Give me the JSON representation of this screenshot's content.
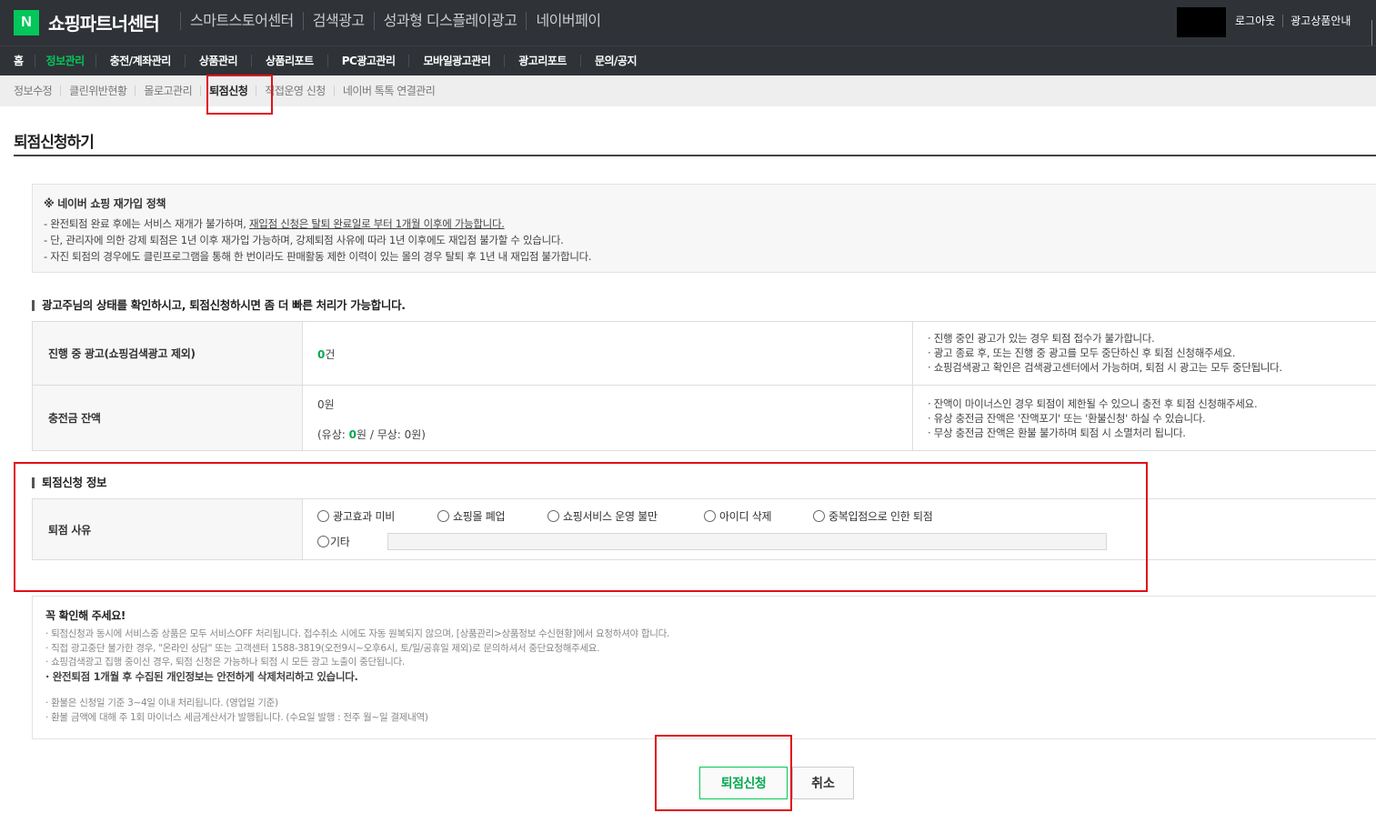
{
  "header": {
    "logo_letter": "N",
    "brand": "쇼핑파트너센터",
    "nav": [
      "스마트스토어센터",
      "검색광고",
      "성과형 디스플레이광고",
      "네이버페이"
    ],
    "links": [
      "로그아웃",
      "광고상품안내"
    ]
  },
  "main_menu": {
    "items": [
      "홈",
      "정보관리",
      "충전/계좌관리",
      "상품관리",
      "상품리포트",
      "PC광고관리",
      "모바일광고관리",
      "광고리포트",
      "문의/공지"
    ],
    "active_index": 1
  },
  "sub_menu": {
    "items": [
      "정보수정",
      "클린위반현황",
      "몰로고관리",
      "퇴점신청",
      "직접운영 신청",
      "네이버 톡톡 연결관리"
    ],
    "active_index": 3
  },
  "page_title": "퇴점신청하기",
  "policy": {
    "head": "※ 네이버 쇼핑 재가입 정책",
    "line1_prefix": "- 완전퇴점 완료 후에는 서비스 재개가 불가하며, ",
    "line1_underlined": "재입점 신청은 탈퇴 완료일로 부터 1개월 이후에 가능합니다.",
    "line2": "- 단, 관리자에 의한 강제 퇴점은 1년 이후 재가입 가능하며, 강제퇴점 사유에 따라 1년 이후에도 재입점 불가할 수 있습니다.",
    "line3": "- 자진 퇴점의 경우에도 클린프로그램을 통해 한 번이라도 판매활동 제한 이력이 있는 몰의 경우 탈퇴 후 1년 내 재입점 불가합니다."
  },
  "status_section": {
    "title": "광고주님의 상태를 확인하시고, 퇴점신청하시면 좀 더 빠른 처리가 가능합니다.",
    "ads": {
      "label": "진행 중 광고(쇼핑검색광고 제외)",
      "count": "0",
      "unit": "건",
      "notes": [
        "· 진행 중인 광고가 있는 경우 퇴점 접수가 불가합니다.",
        "· 광고 종료 후, 또는 진행 중 광고를 모두 중단하신 후 퇴점 신청해주세요.",
        "· 쇼핑검색광고 확인은 검색광고센터에서 가능하며, 퇴점 시 광고는 모두 중단됩니다."
      ]
    },
    "balance": {
      "label": "충전금 잔액",
      "total": "0원",
      "paid_prefix": "(유상: ",
      "paid_value": "0",
      "paid_suffix": "원 / 무상: 0원)",
      "notes": [
        "· 잔액이 마이너스인 경우 퇴점이 제한될 수 있으니 충전 후 퇴점 신청해주세요.",
        "· 유상 충전금 잔액은 '잔액포기' 또는 '환불신청' 하실 수 있습니다.",
        "· 무상 충전금 잔액은 환불 불가하며 퇴점 시 소멸처리 됩니다."
      ]
    }
  },
  "reason_section": {
    "title": "퇴점신청 정보",
    "label": "퇴점 사유",
    "options": [
      "광고효과 미비",
      "쇼핑몰 폐업",
      "쇼핑서비스 운영 불만",
      "아이디 삭제",
      "중복입점으로 인한 퇴점"
    ],
    "etc_label": "기타",
    "etc_value": ""
  },
  "notice": {
    "head": "꼭 확인해 주세요!",
    "lines": [
      "· 퇴점신청과 동시에 서비스중 상품은 모두 서비스OFF 처리됩니다. 접수취소 시에도 자동 원복되지 않으며, [상품관리>상품정보 수신현황]에서 요청하셔야 합니다.",
      "· 직접 광고중단 불가한 경우, \"온라인 상담\" 또는 고객센터 1588-3819(오전9시~오후6시, 토/일/공휴일 제외)로 문의하셔서 중단요청해주세요.",
      "· 쇼핑검색광고 집행 중이신 경우, 퇴점 신청은 가능하나 퇴점 시 모든 광고 노출이 중단됩니다."
    ],
    "bold_line": "· 완전퇴점 1개월 후 수집된 개인정보는 안전하게 삭제처리하고 있습니다.",
    "lines2": [
      "· 환불은 신청일 기준 3~4일 이내 처리됩니다. (영업일 기준)",
      "· 환불 금액에 대해 주 1회 마이너스 세금계산서가 발행됩니다. (수요일 발행 : 전주 월~일 결제내역)"
    ]
  },
  "buttons": {
    "submit": "퇴점신청",
    "cancel": "취소"
  },
  "colors": {
    "naver_green": "#03c75a",
    "header_bg": "#2f3237",
    "highlight_red": "#e0101a"
  }
}
